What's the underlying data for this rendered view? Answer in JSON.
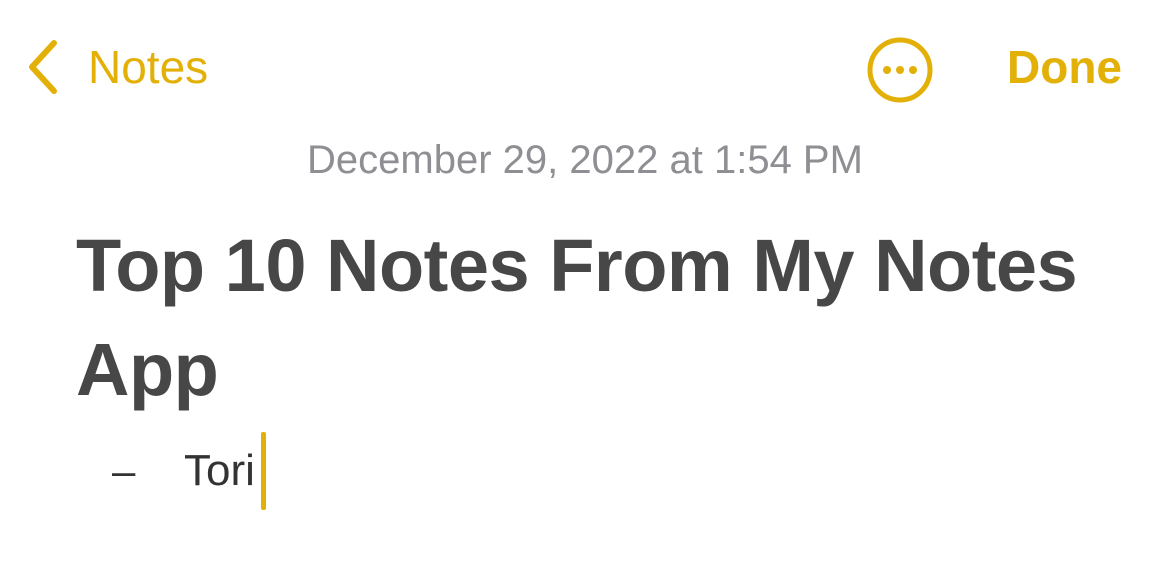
{
  "nav": {
    "back_label": "Notes",
    "done_label": "Done",
    "accent_color": "#E3B008",
    "back_icon": "chevron-left-icon",
    "more_icon": "ellipsis-circle-icon"
  },
  "note": {
    "timestamp": "December 29, 2022 at 1:54 PM",
    "title": "Top 10 Notes From My Notes App",
    "bullet_marker": "–",
    "bullet_text": "Tori"
  }
}
